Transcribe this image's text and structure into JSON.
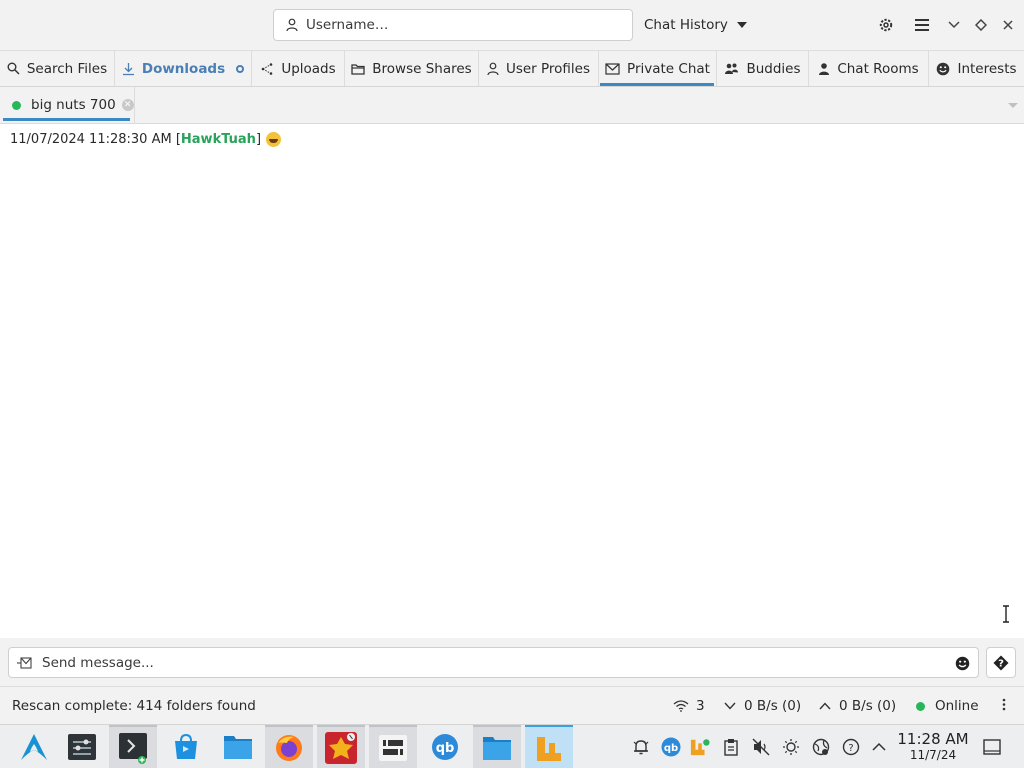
{
  "header": {
    "username_placeholder": "Username…",
    "chat_history_label": "Chat History"
  },
  "tabs": [
    {
      "label": "Search Files",
      "icon": "search-icon"
    },
    {
      "label": "Downloads",
      "icon": "download-icon"
    },
    {
      "label": "Uploads",
      "icon": "upload-icon"
    },
    {
      "label": "Browse Shares",
      "icon": "folder-icon"
    },
    {
      "label": "User Profiles",
      "icon": "user-icon"
    },
    {
      "label": "Private Chat",
      "icon": "mail-icon"
    },
    {
      "label": "Buddies",
      "icon": "users-icon"
    },
    {
      "label": "Chat Rooms",
      "icon": "user-icon"
    },
    {
      "label": "Interests",
      "icon": "smiley-icon"
    }
  ],
  "active_tab": "Private Chat",
  "chat_tab": {
    "name": "big nuts 700",
    "status": "online"
  },
  "messages": [
    {
      "timestamp": "11/07/2024 11:28:30 AM",
      "open_bracket": "[",
      "user": "HawkTuah",
      "close_bracket": "]",
      "emoji": "grinning-face"
    }
  ],
  "input": {
    "placeholder": "Send message..."
  },
  "statusbar": {
    "text": "Rescan complete: 414 folders found",
    "connections": "3",
    "download_speed": "0 B/s (0)",
    "upload_speed": "0 B/s (0)",
    "status": "Online"
  },
  "taskbar": {
    "time": "11:28 AM",
    "date": "11/7/24"
  },
  "colors": {
    "accent": "#3b8ac4",
    "online": "#27b65a",
    "username": "#27a35a",
    "downloads": "#4a7fb5"
  }
}
